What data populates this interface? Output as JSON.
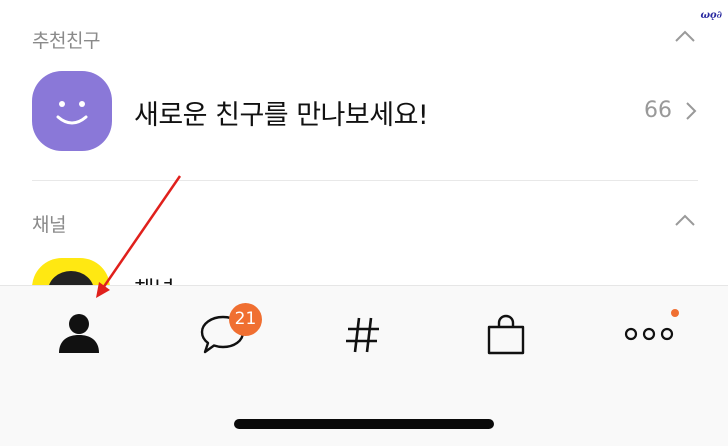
{
  "friends_section": {
    "title": "추천친구",
    "new_friends_text": "새로운 친구를 만나보세요!",
    "count": "66"
  },
  "channel_section": {
    "title": "채널",
    "first_item_name": "채널"
  },
  "tabbar": {
    "tabs": [
      {
        "name": "friends",
        "icon": "person-icon",
        "active": true
      },
      {
        "name": "chats",
        "icon": "chat-bubble-icon",
        "badge": "21"
      },
      {
        "name": "view",
        "icon": "hashtag-icon"
      },
      {
        "name": "shopping",
        "icon": "shopping-bag-icon"
      },
      {
        "name": "more",
        "icon": "more-dots-icon",
        "dot": true
      }
    ]
  },
  "colors": {
    "accent_badge": "#f06f31",
    "avatar_purple": "#8a78d8",
    "channel_yellow": "#ffe812",
    "annotation_arrow": "#e0201c"
  }
}
